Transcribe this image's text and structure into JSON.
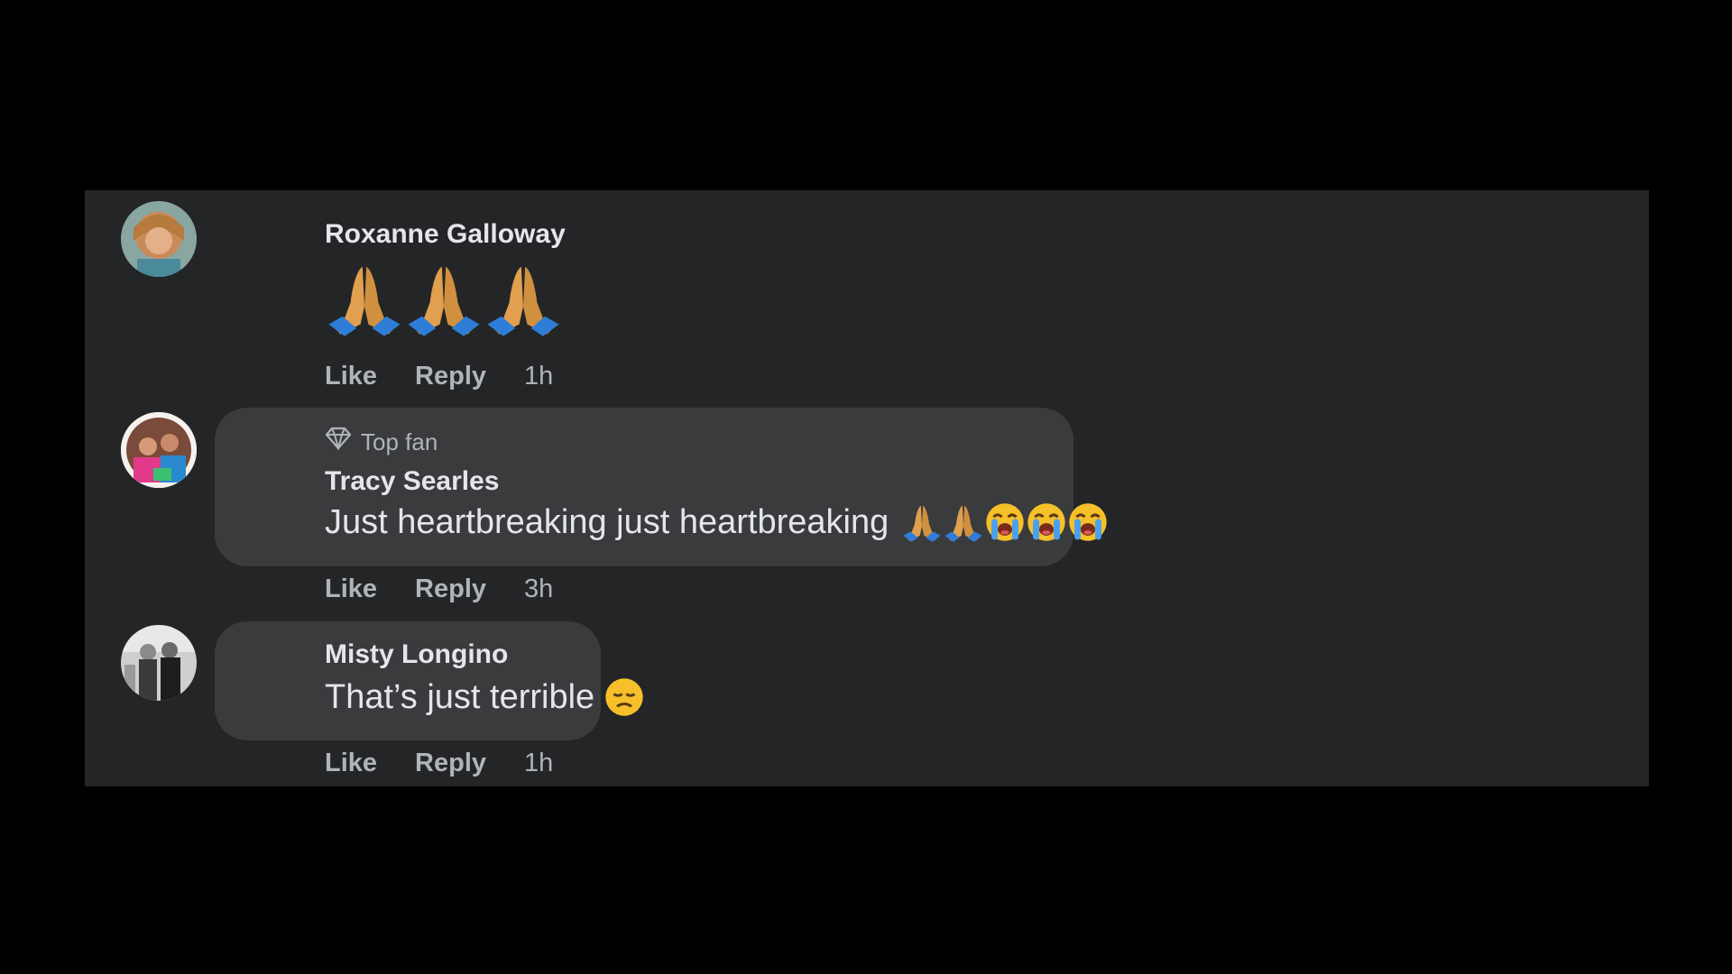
{
  "comments": [
    {
      "author": "Roxanne Galloway",
      "text": "🙏🙏🙏",
      "actions": {
        "like": "Like",
        "reply": "Reply",
        "time": "1h"
      }
    },
    {
      "badge": "Top fan",
      "author": "Tracy Searles",
      "text": "Just heartbreaking just heartbreaking 🙏🙏😭😭😭",
      "text_main": "Just heartbreaking just heartbreaking",
      "actions": {
        "like": "Like",
        "reply": "Reply",
        "time": "3h"
      }
    },
    {
      "author": "Misty Longino",
      "text": "That’s just terrible 😞",
      "text_main": "That’s just terrible",
      "actions": {
        "like": "Like",
        "reply": "Reply",
        "time": "1h"
      }
    }
  ],
  "icons": {
    "badge": "diamond-icon",
    "praying": "praying-hands-emoji",
    "crying": "loudly-crying-face-emoji",
    "disappointed": "disappointed-face-emoji"
  },
  "colors": {
    "page_background": "#000000",
    "panel_background": "#242526",
    "bubble_background": "#3a3b3c",
    "primary_text": "#e4e6eb",
    "secondary_text": "#b0b3b8"
  }
}
